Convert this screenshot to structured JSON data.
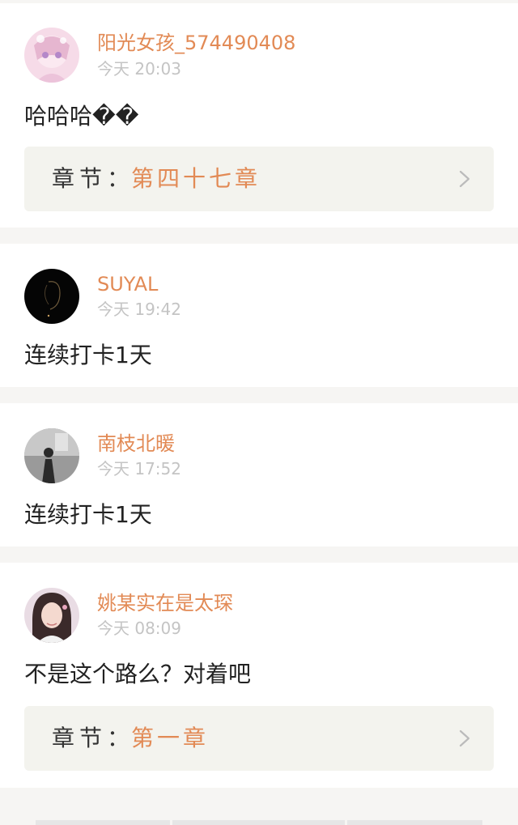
{
  "comments": [
    {
      "username": "阳光女孩_574490408",
      "time": "今天 20:03",
      "content": "哈哈哈��",
      "chapter": {
        "label": "章节：",
        "name": "第四十七章"
      }
    },
    {
      "username": "SUYAL",
      "time": "今天 19:42",
      "content": "连续打卡1天"
    },
    {
      "username": "南枝北暖",
      "time": "今天 17:52",
      "content": "连续打卡1天"
    },
    {
      "username": "姚某实在是太琛",
      "time": "今天 08:09",
      "content": "不是这个路么？对着吧",
      "chapter": {
        "label": "章节：",
        "name": "第一章"
      }
    }
  ],
  "colors": {
    "username": "#e28a55",
    "timestamp": "#c4c4c4",
    "background": "#f6f5f3",
    "chapter_box": "#f3f3ee"
  },
  "icons": {
    "chevron": "chevron-right-icon"
  }
}
